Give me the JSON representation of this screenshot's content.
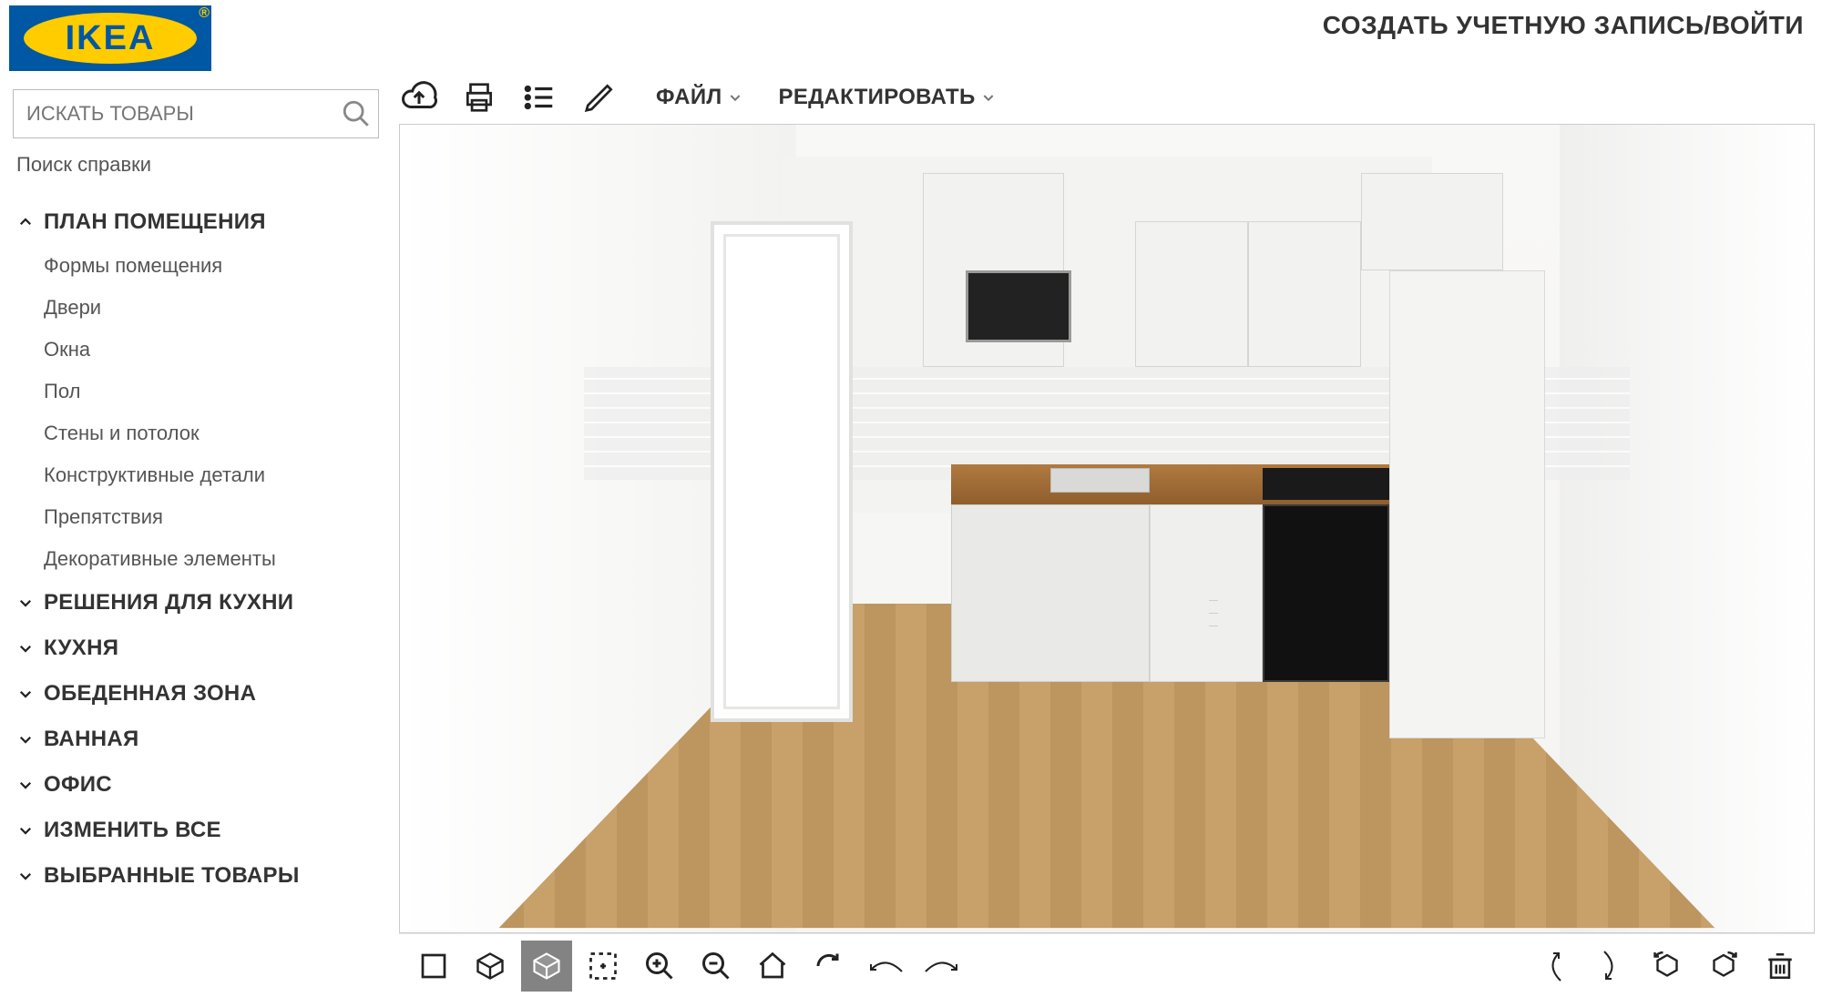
{
  "brand": "IKEA",
  "header": {
    "login": "СОЗДАТЬ УЧЕТНУЮ ЗАПИСЬ/ВОЙТИ"
  },
  "search": {
    "placeholder": "ИСКАТЬ ТОВАРЫ",
    "help": "Поиск справки"
  },
  "menus": {
    "file": "ФАЙЛ",
    "edit": "РЕДАКТИРОВАТЬ"
  },
  "sidebar": {
    "sections": [
      {
        "label": "ПЛАН ПОМЕЩЕНИЯ",
        "expanded": true,
        "items": [
          "Формы помещения",
          "Двери",
          "Окна",
          "Пол",
          "Стены и потолок",
          "Конструктивные детали",
          "Препятствия",
          "Декоративные элементы"
        ]
      },
      {
        "label": "РЕШЕНИЯ ДЛЯ КУХНИ",
        "expanded": false
      },
      {
        "label": "КУХНЯ",
        "expanded": false
      },
      {
        "label": "ОБЕДЕННАЯ ЗОНА",
        "expanded": false
      },
      {
        "label": "ВАННАЯ",
        "expanded": false
      },
      {
        "label": "ОФИС",
        "expanded": false
      },
      {
        "label": "ИЗМЕНИТЬ ВСЕ",
        "expanded": false
      },
      {
        "label": "ВЫБРАННЫЕ ТОВАРЫ",
        "expanded": false
      }
    ]
  },
  "top_toolbar": {
    "icons": [
      "cloud-upload-icon",
      "print-icon",
      "list-icon",
      "pencil-icon"
    ]
  },
  "bottom_toolbar": {
    "left": [
      {
        "name": "view-2d-icon",
        "active": false
      },
      {
        "name": "view-3d-wire-icon",
        "active": false
      },
      {
        "name": "view-3d-solid-icon",
        "active": true
      },
      {
        "name": "zoom-fit-icon",
        "active": false
      },
      {
        "name": "zoom-in-icon",
        "active": false
      },
      {
        "name": "zoom-out-icon",
        "active": false
      },
      {
        "name": "home-icon",
        "active": false
      },
      {
        "name": "redo-icon",
        "active": false
      },
      {
        "name": "pan-left-icon",
        "active": false
      },
      {
        "name": "pan-right-icon",
        "active": false
      }
    ],
    "right": [
      {
        "name": "orbit-up-icon"
      },
      {
        "name": "orbit-down-icon"
      },
      {
        "name": "rotate-ccw-icon"
      },
      {
        "name": "rotate-cw-icon"
      },
      {
        "name": "trash-icon"
      }
    ]
  }
}
